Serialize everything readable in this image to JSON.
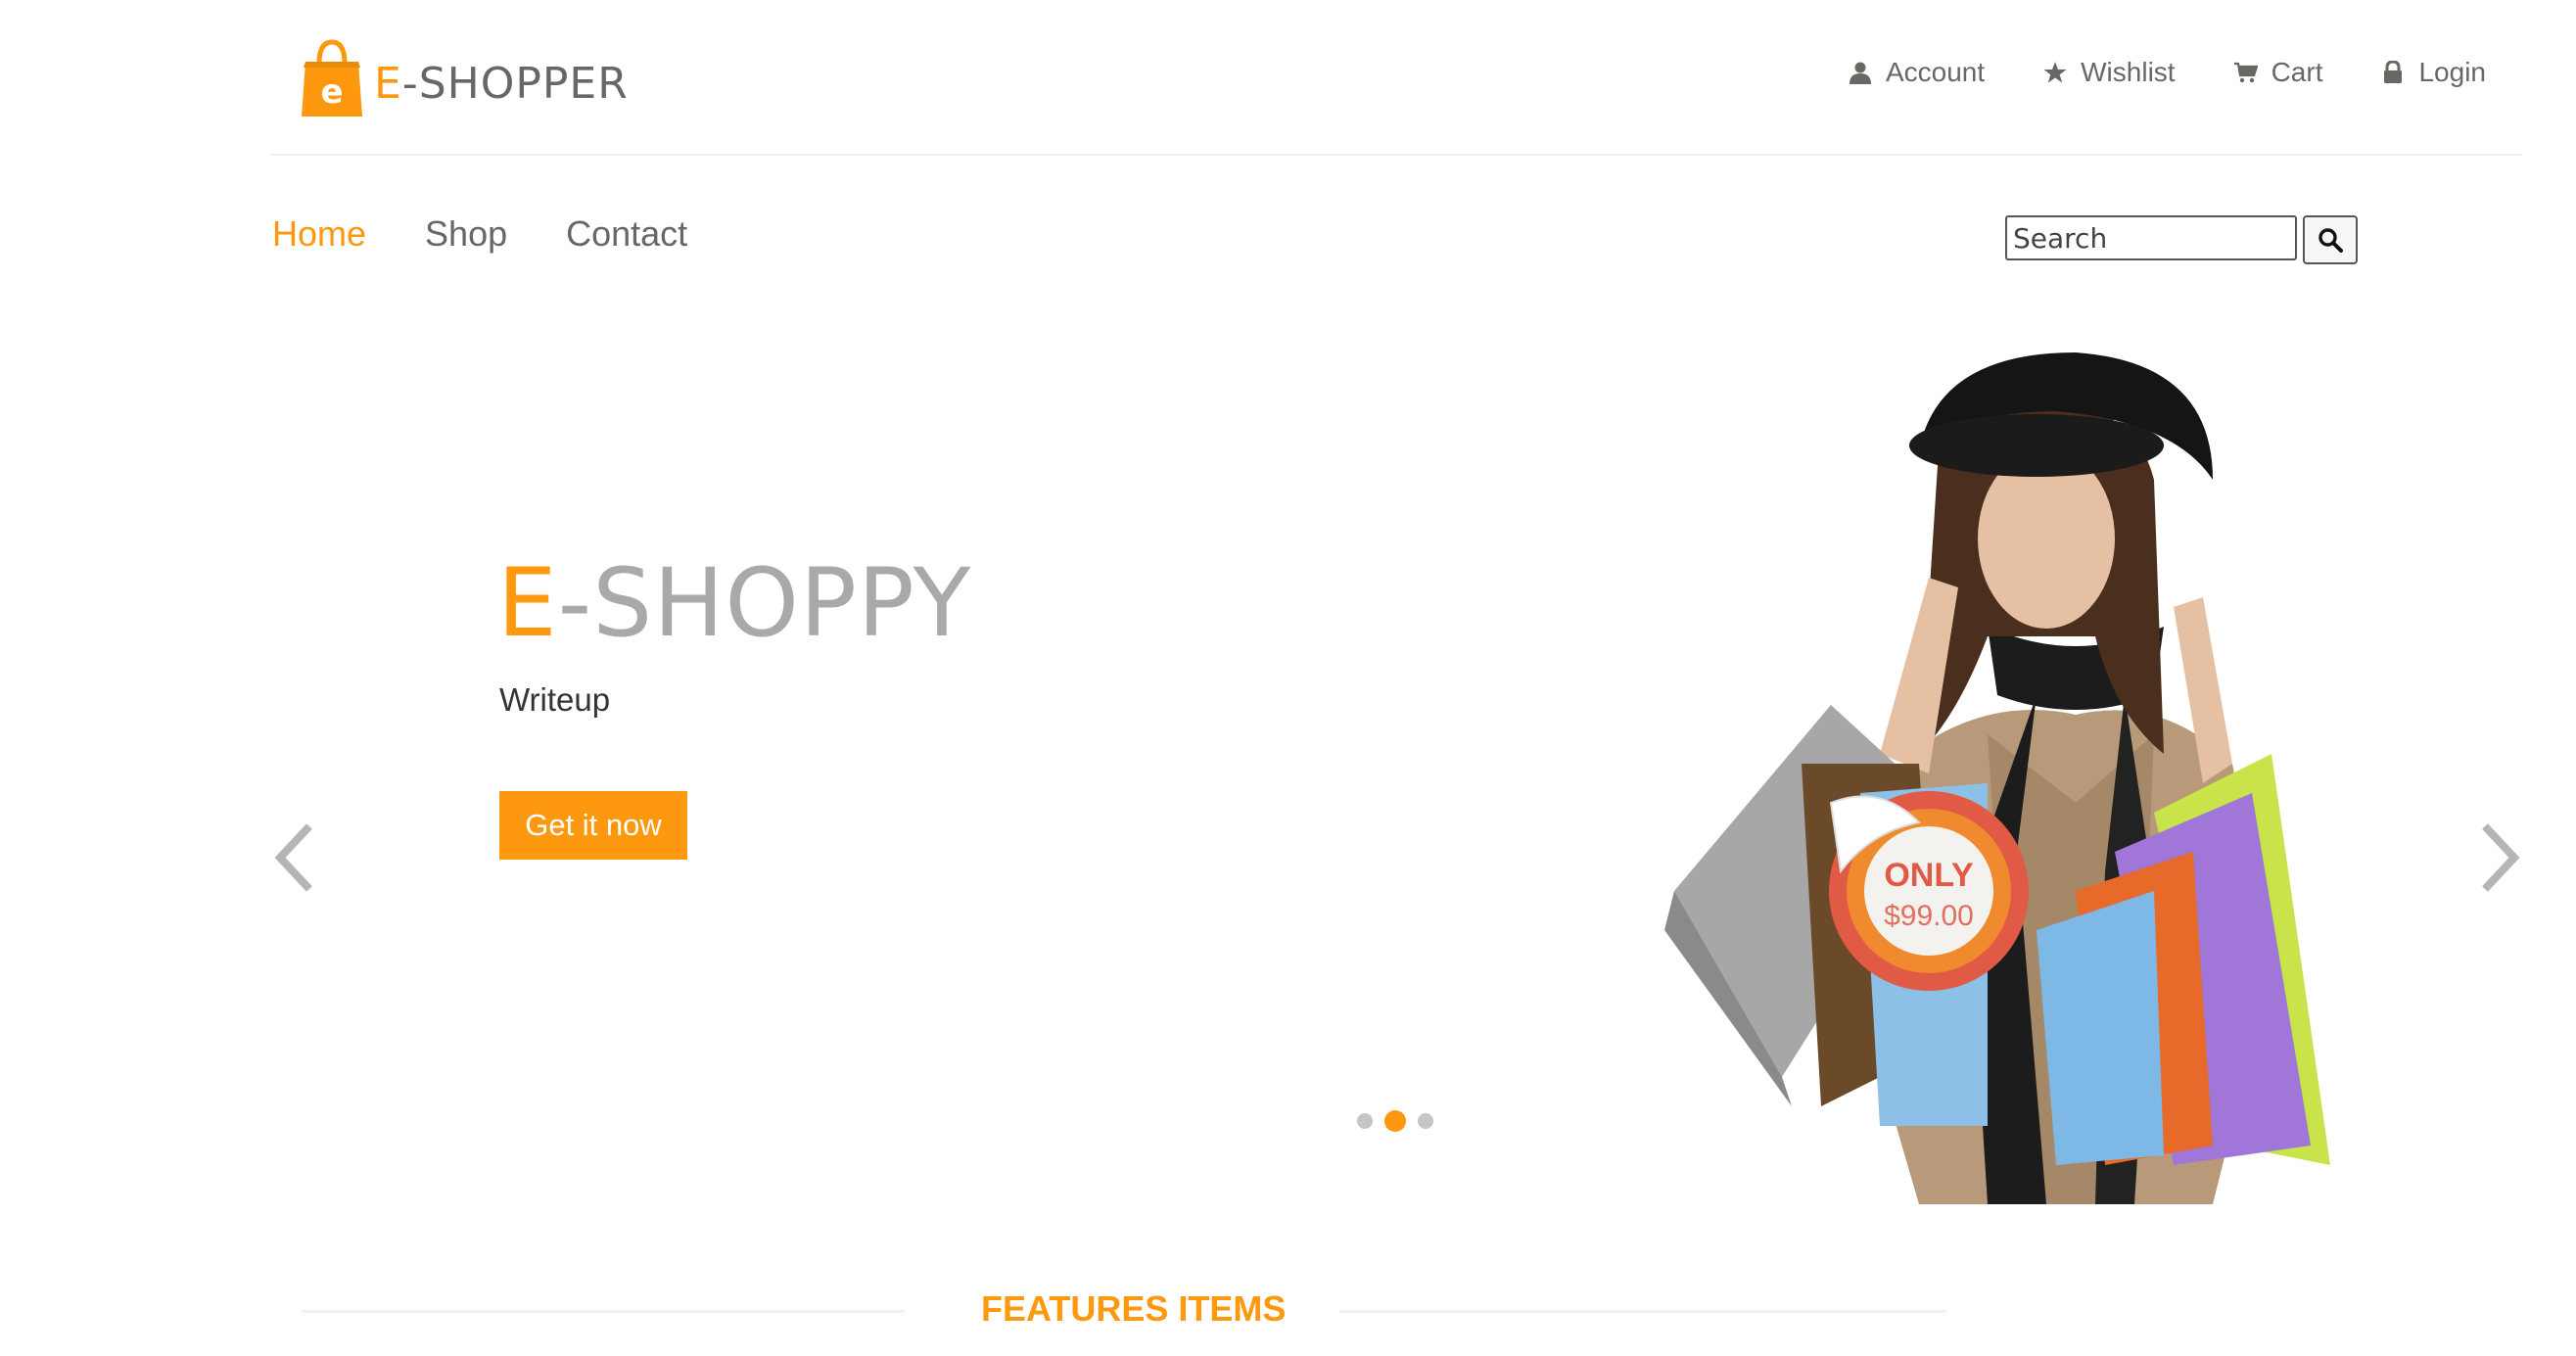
{
  "brand": {
    "logo_letter": "e",
    "logo_first": "E",
    "logo_rest": "-SHOPPER",
    "accent_color": "#FE980F"
  },
  "topnav": {
    "items": [
      {
        "label": "Account",
        "icon": "user-icon"
      },
      {
        "label": "Wishlist",
        "icon": "star-icon"
      },
      {
        "label": "Cart",
        "icon": "cart-icon"
      },
      {
        "label": "Login",
        "icon": "lock-icon"
      }
    ]
  },
  "mainnav": {
    "items": [
      {
        "label": "Home",
        "active": true
      },
      {
        "label": "Shop",
        "active": false
      },
      {
        "label": "Contact",
        "active": false
      }
    ]
  },
  "search": {
    "placeholder": "Search",
    "icon": "search-icon"
  },
  "slider": {
    "title_first": "E",
    "title_rest": "-SHOPPY",
    "subtitle": "Writeup",
    "button_label": "Get it now",
    "prev_icon": "chevron-left-icon",
    "next_icon": "chevron-right-icon",
    "dots_count": 3,
    "active_dot": 2,
    "price_badge": {
      "only": "ONLY",
      "price": "$99.00"
    }
  },
  "features": {
    "title": "FEATURES ITEMS"
  }
}
